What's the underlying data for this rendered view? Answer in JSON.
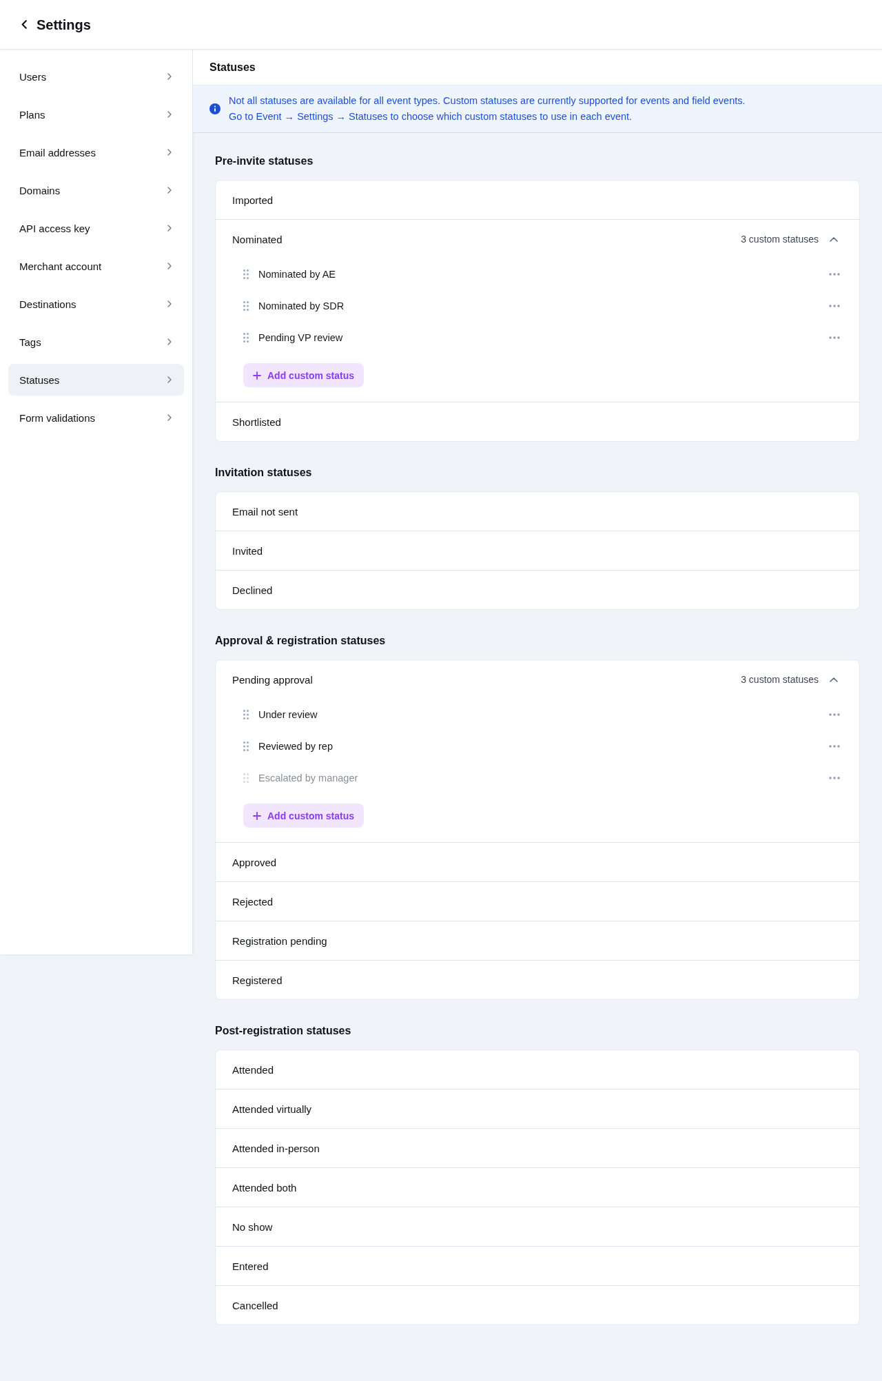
{
  "header": {
    "title": "Settings"
  },
  "sidebar": {
    "items": [
      {
        "label": "Users",
        "selected": false
      },
      {
        "label": "Plans",
        "selected": false
      },
      {
        "label": "Email addresses",
        "selected": false
      },
      {
        "label": "Domains",
        "selected": false
      },
      {
        "label": "API access key",
        "selected": false
      },
      {
        "label": "Merchant account",
        "selected": false
      },
      {
        "label": "Destinations",
        "selected": false
      },
      {
        "label": "Tags",
        "selected": false
      },
      {
        "label": "Statuses",
        "selected": true
      },
      {
        "label": "Form validations",
        "selected": false
      }
    ]
  },
  "page": {
    "title": "Statuses"
  },
  "notice": {
    "lines": [
      "Not all statuses are available for all event types. Custom statuses are currently supported for events and field events.",
      "Go to Event → Settings → Statuses to choose which custom statuses to use in each event."
    ]
  },
  "groups": [
    {
      "title": "Pre-invite statuses",
      "statuses": [
        {
          "kind": "plain",
          "label": "Imported"
        },
        {
          "kind": "custom",
          "label": "Nominated",
          "count": "3 custom statuses",
          "expanded": true,
          "custom_statuses": [
            {
              "label": "Nominated by AE",
              "disabled": false
            },
            {
              "label": "Nominated by SDR",
              "disabled": false
            },
            {
              "label": "Pending VP review",
              "disabled": false
            }
          ],
          "add_label": "Add custom status"
        },
        {
          "kind": "plain",
          "label": "Shortlisted"
        }
      ]
    },
    {
      "title": "Invitation statuses",
      "statuses": [
        {
          "kind": "plain",
          "label": "Email not sent"
        },
        {
          "kind": "plain",
          "label": "Invited"
        },
        {
          "kind": "plain",
          "label": "Declined"
        }
      ]
    },
    {
      "title": "Approval & registration statuses",
      "statuses": [
        {
          "kind": "custom",
          "label": "Pending approval",
          "count": "3 custom statuses",
          "expanded": true,
          "custom_statuses": [
            {
              "label": "Under review",
              "disabled": false
            },
            {
              "label": "Reviewed by rep",
              "disabled": false
            },
            {
              "label": "Escalated by manager",
              "disabled": true
            }
          ],
          "add_label": "Add custom status"
        },
        {
          "kind": "plain",
          "label": "Approved"
        },
        {
          "kind": "plain",
          "label": "Rejected"
        },
        {
          "kind": "plain",
          "label": "Registration pending"
        },
        {
          "kind": "plain",
          "label": "Registered"
        }
      ]
    },
    {
      "title": "Post-registration statuses",
      "statuses": [
        {
          "kind": "plain",
          "label": "Attended"
        },
        {
          "kind": "plain",
          "label": "Attended virtually"
        },
        {
          "kind": "plain",
          "label": "Attended in-person"
        },
        {
          "kind": "plain",
          "label": "Attended both"
        },
        {
          "kind": "plain",
          "label": "No show"
        },
        {
          "kind": "plain",
          "label": "Entered"
        },
        {
          "kind": "plain",
          "label": "Cancelled"
        }
      ]
    }
  ]
}
